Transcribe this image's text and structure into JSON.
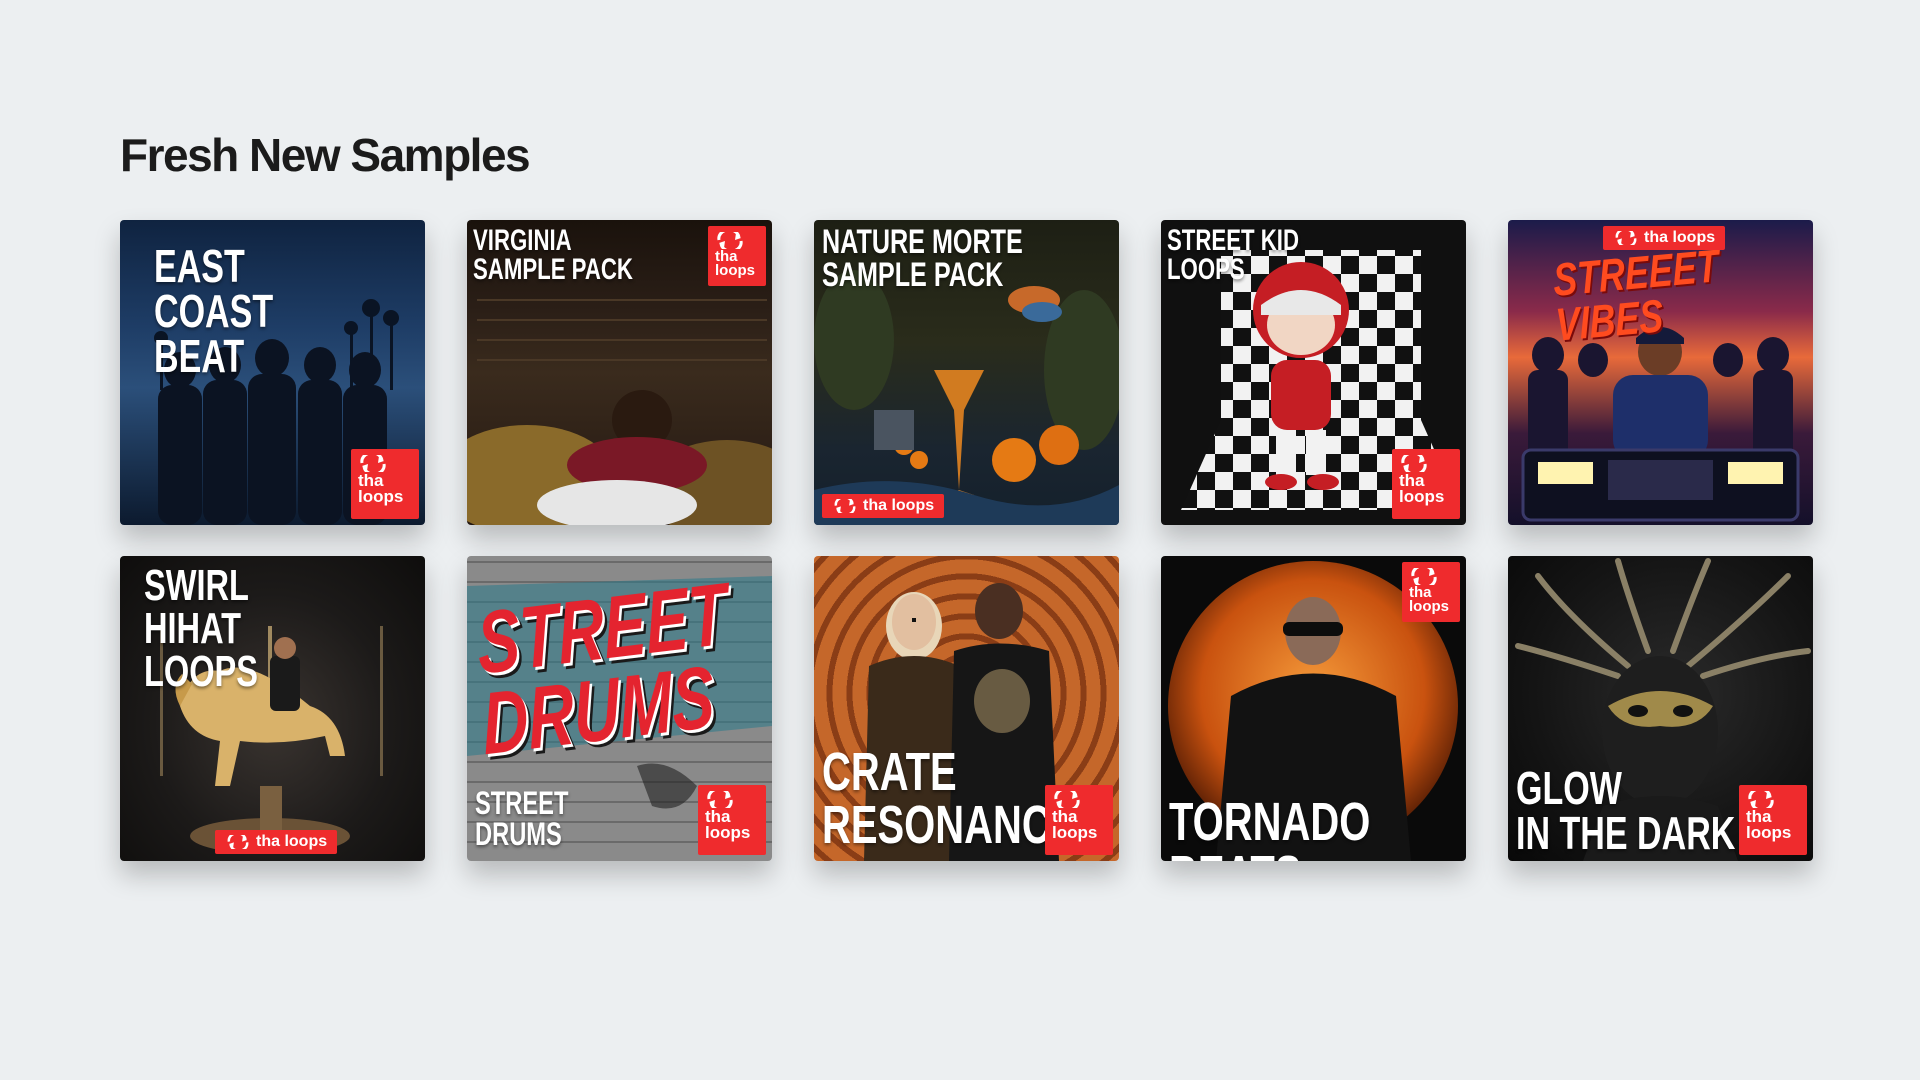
{
  "section": {
    "title": "Fresh New Samples"
  },
  "badge": {
    "line1": "tha",
    "line2": "loops",
    "wide": "tha loops",
    "color": "#ef2b2d"
  },
  "cards": [
    {
      "title": "EAST COAST BEAT"
    },
    {
      "title": "VIRGINIA\nSAMPLE PACK"
    },
    {
      "title": "NATURE MORTE SAMPLE PACK"
    },
    {
      "title": "STREET KID\nLOOPS"
    },
    {
      "title": "STREEET VIBES"
    },
    {
      "title": "SWIRL HIHAT LOOPS"
    },
    {
      "title": "STREET\nDRUMS",
      "graffiti": "STREET\nDRUMS"
    },
    {
      "title": "CRATE\nRESONANCE"
    },
    {
      "title": "TORNADO BEATS"
    },
    {
      "title": "GLOW\nIN THE DARK"
    }
  ]
}
